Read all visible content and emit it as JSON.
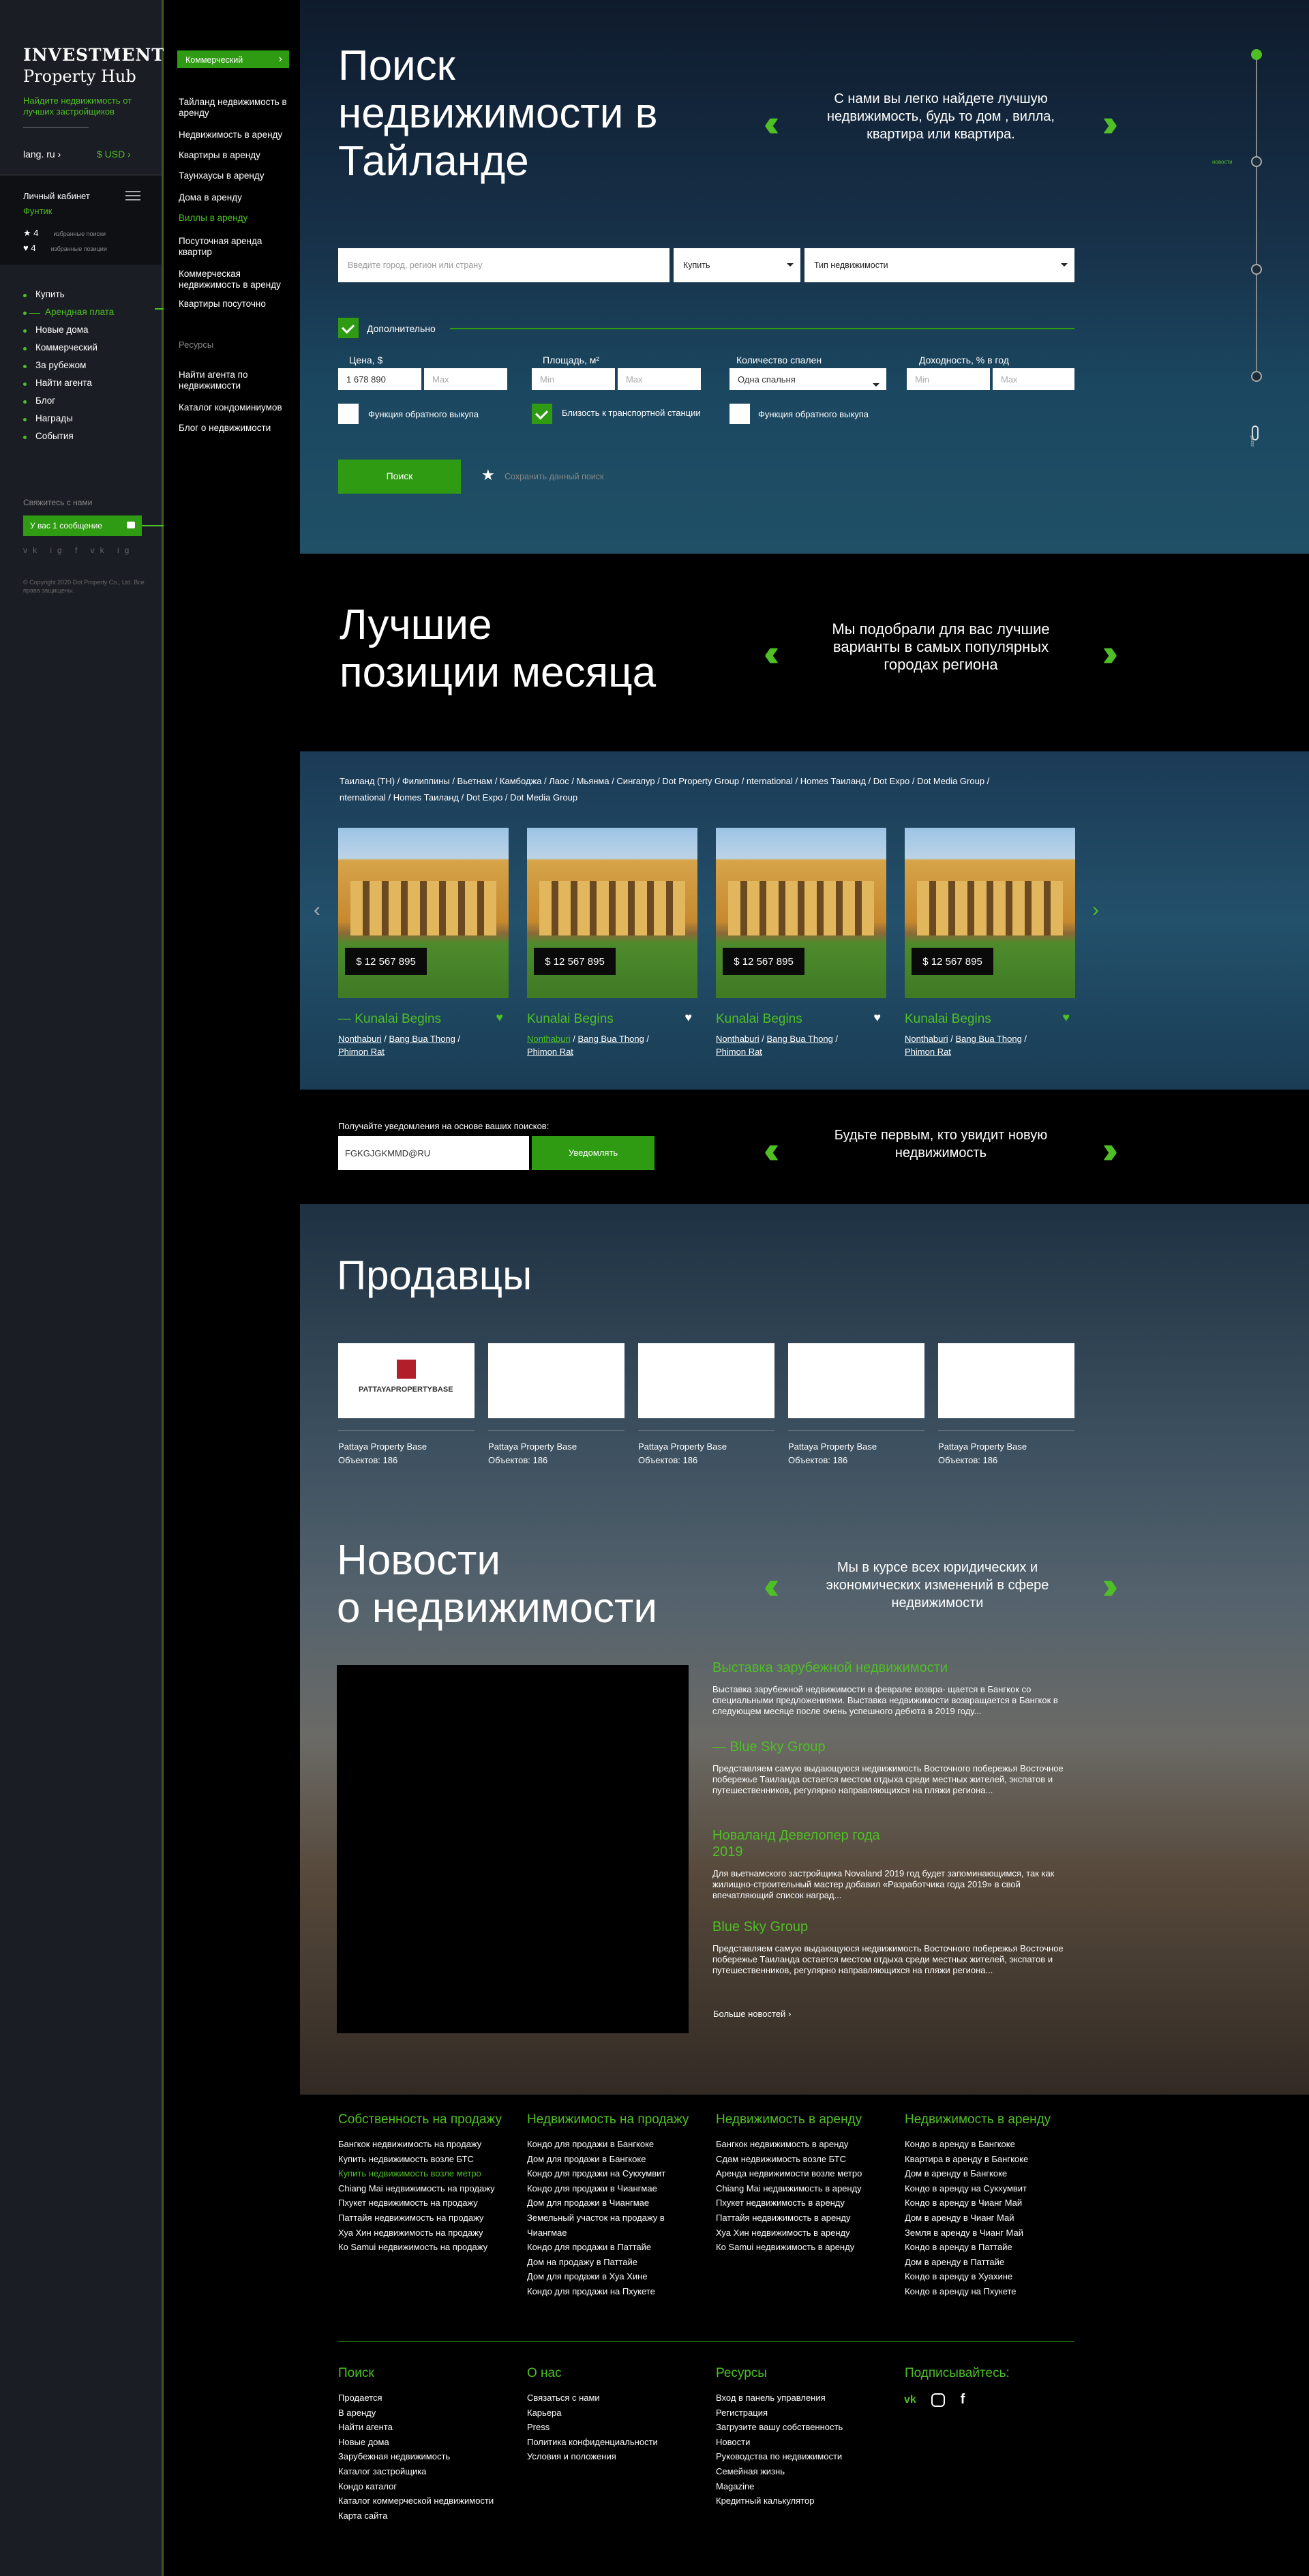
{
  "sidebar": {
    "brand_line1": "INVESTMENT",
    "brand_line2": "Property Hub",
    "tagline": "Найдите недвижимость от лучших застройщиков",
    "lang": "lang. ru",
    "lang_arrow": "›",
    "currency": "$ USD",
    "currency_arrow": "›",
    "cabinet": "Личный кабинет",
    "user": "Фунтик",
    "fav_label": "избранные поиски",
    "fav_count": "4",
    "fav_props_label": "избранные позиции",
    "fav_props_count": "4",
    "nav": [
      "Купить",
      "Арендная плата",
      "Новые дома",
      "Коммерческий",
      "За рубежом",
      "Найти агента",
      "Блог",
      "Награды",
      "События"
    ],
    "contact": "Свяжитесь с нами",
    "messages": "У вас 1 сообщение",
    "social": "vk ig f vk ig",
    "copyright": "© Copyright 2020 Dot Property Co., Ltd. Все права защищены."
  },
  "submenu": {
    "button": "Коммерческий",
    "items": [
      "Тайланд недвижимость в аренду",
      "Недвижимость в аренду",
      "Квартиры в аренду",
      "Таунхаусы в аренду",
      "Дома в аренду",
      "Виллы в аренду",
      "Посуточная аренда квартир",
      "Коммерческая недвижимость в аренду",
      "Квартиры посуточно"
    ],
    "resources_title": "Ресурсы",
    "resources": [
      "Найти агента по недвижимости",
      "Каталог кондоминиумов",
      "Блог о недвижимости"
    ]
  },
  "hero": {
    "title": "Поиск недвижимости в Тайланде",
    "quote": "С нами вы легко найдете лучшую недвижимость, будь то дом , вилла, квартира или квартира.",
    "search_placeholder": "Введите город, регион или страну",
    "buy": "Купить",
    "type": "Тип недвижимости",
    "more": "Дополнительно",
    "price_label": "Цена, $",
    "price_min": "1 678 890",
    "price_max": "Max",
    "area_label": "Площадь, м²",
    "area_min": "Min",
    "area_max": "Max",
    "beds_label": "Количество спален",
    "beds_value": "Одна спальня",
    "yield_label": "Доходность, % в год",
    "yield_min": "Min",
    "yield_max": "Max",
    "opt1": "Функция обратного выкупа",
    "opt2": "Близость к транспортной станции",
    "opt3": "Функция обратного выкупа",
    "search_btn": "Поиск",
    "save": "Сохранить данный поиск",
    "timeline_label": "новости",
    "scroll": "scroll"
  },
  "best": {
    "title_line1": "Лучшие",
    "title_line2": "позиции месяца",
    "quote": "Мы подобрали для вас лучшие варианты в самых популярных городах региона"
  },
  "listings": {
    "crumbs_line1": "Таиланд (TH) / Филиппины / Вьетнам / Камбоджа / Лаос / Мьянма / Сингапур / Dot Property Group / nternational / Homes Таиланд / Dot Expo / Dot Media Group /",
    "crumbs_line2": "nternational / Homes Таиланд / Dot Expo / Dot Media Group",
    "cards": [
      {
        "price": "$ 12 567 895",
        "name": "— Kunalai Begins",
        "loc1": "Nonthaburi",
        "loc2": "Bang Bua Thong",
        "loc3": "Phimon Rat"
      },
      {
        "price": "$ 12 567 895",
        "name": "Kunalai Begins",
        "loc1": "Nonthaburi",
        "loc2": "Bang Bua Thong",
        "loc3": "Phimon Rat"
      },
      {
        "price": "$ 12 567 895",
        "name": "Kunalai Begins",
        "loc1": "Nonthaburi",
        "loc2": "Bang Bua Thong",
        "loc3": "Phimon Rat"
      },
      {
        "price": "$ 12 567 895",
        "name": "Kunalai Begins",
        "loc1": "Nonthaburi",
        "loc2": "Bang Bua Thong",
        "loc3": "Phimon Rat"
      }
    ]
  },
  "notify": {
    "label": "Получайте уведомления на основе ваших поисков:",
    "email": "FGKGJGKMMD@RU",
    "button": "Уведомлять",
    "quote": "Будьте первым, кто увидит новую недвижимость"
  },
  "sellers": {
    "title": "Продавцы",
    "items": [
      {
        "name": "Pattaya Property Base",
        "count": "Объектов: 186",
        "logo": "PATTAYAPROPERTYBASE"
      },
      {
        "name": "Pattaya Property Base",
        "count": "Объектов: 186"
      },
      {
        "name": "Pattaya Property Base",
        "count": "Объектов: 186"
      },
      {
        "name": "Pattaya Property Base",
        "count": "Объектов: 186"
      },
      {
        "name": "Pattaya Property Base",
        "count": "Объектов: 186"
      }
    ]
  },
  "news": {
    "title_line1": "Новости",
    "title_line2": "о недвижимости",
    "quote": "Мы в курсе всех юридических и экономических изменений в сфере недвижимости",
    "items": [
      {
        "title": "Выставка зарубежной недвижимости",
        "desc": "Выставка зарубежной недвижимости в феврале возвра- щается в Бангкок со специальными предложениями. Выставка недвижимости возвращается в Бангкок в следующем месяце после очень успешного дебюта в 2019 году..."
      },
      {
        "title": "— Blue Sky Group",
        "desc": "Представляем самую выдающуюся недвижимость Восточного побережья Восточное побережье Таиланда остается местом отдыха среди местных жителей, экспатов и путешественников, регулярно направляющихся на пляжи региона..."
      },
      {
        "title": "Новаланд Девелопер года 2019",
        "desc": "Для вьетнамского застройщика Novaland 2019 год будет запоминающимся, так как жилищно-строительный мастер добавил «Разработчика года 2019» в свой впечатляющий список наград..."
      },
      {
        "title": "Blue Sky Group",
        "desc": "Представляем самую выдающуюся недвижимость Восточного побережья Восточное побережье Таиланда остается местом отдыха среди местных жителей, экспатов и путешественников, регулярно направляющихся на пляжи региона..."
      }
    ],
    "more": "Больше новостей"
  },
  "footer": {
    "cols": [
      {
        "title": "Собственность на продажу",
        "items": [
          "Бангкок недвижимость на продажу",
          "Купить недвижимость возле БТС",
          "Купить недвижимость возле метро",
          "Chiang Mai недвижимость на продажу",
          "Пхукет недвижимость на продажу",
          "Паттайя недвижимость на продажу",
          "Хуа Хин недвижимость на продажу",
          "Ко Samui недвижимость на продажу"
        ]
      },
      {
        "title": "Недвижимость на продажу",
        "items": [
          "Кондо для продажи в Бангкоке",
          "Дом для продажи в Бангкоке",
          "Кондо для продажи на Сукхумвит",
          "Кондо для продажи в Чиангмае",
          "Дом для продажи в Чиангмае",
          "Земельный участок на продажу в Чиангмае",
          "Кондо для продажи в Паттайе",
          "Дом на продажу в Паттайе",
          "Дом для продажи в Хуа Хине",
          "Кондо для продажи на Пхукете"
        ]
      },
      {
        "title": "Недвижимость в аренду",
        "items": [
          "Бангкок недвижимость в аренду",
          "Сдам недвижимость возле БТС",
          "Аренда недвижимости возле метро",
          "Chiang Mai недвижимость в аренду",
          "Пхукет недвижимость в аренду",
          "Паттайя недвижимость в аренду",
          "Хуа Хин недвижимость в аренду",
          "Ко Samui недвижимость в аренду"
        ]
      },
      {
        "title": "Недвижимость в аренду",
        "items": [
          "Кондо в аренду в Бангкоке",
          "Квартира в аренду в Бангкоке",
          "Дом в аренду в Бангкоке",
          "Кондо в аренду на Сукхумвит",
          "Кондо в аренду в Чианг Май",
          "Дом в аренду в Чианг Май",
          "Земля в аренду в Чианг Май",
          "Кондо в аренду в Паттайе",
          "Дом в аренду в Паттайе",
          "Кондо в аренду в Хуахине",
          "Кондо в аренду на Пхукете"
        ]
      }
    ],
    "cols2": [
      {
        "title": "Поиск",
        "items": [
          "Продается",
          "В аренду",
          "Найти агента",
          "Новые дома",
          "Зарубежная недвижимость",
          "Каталог застройщика",
          "Кондо каталог",
          "Каталог коммерческой недвижимости",
          "Карта сайта"
        ]
      },
      {
        "title": "О нас",
        "items": [
          "Связаться с нами",
          "Карьера",
          "Press",
          "Политика конфиденциальности",
          "Условия и положения"
        ]
      },
      {
        "title": "Ресурсы",
        "items": [
          "Вход в панель управления",
          "Регистрация",
          "Загрузите вашу собственность",
          "Новости",
          "Руководства по недвижимости",
          "Семейная жизнь",
          "Magazine",
          "Кредитный калькулятор"
        ]
      },
      {
        "title": "Подписывайтесь:",
        "items": []
      }
    ]
  }
}
